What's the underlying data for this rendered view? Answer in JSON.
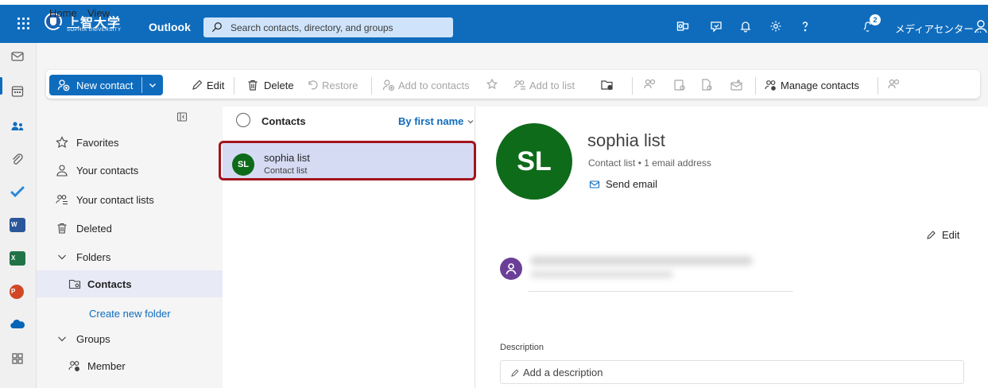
{
  "header": {
    "university_name_jp": "上智大学",
    "university_name_en": "SOPHIA UNIVERSITY",
    "app_name": "Outlook",
    "search_placeholder": "Search contacts, directory, and groups",
    "notification_count": "2",
    "user_name": "メディアセンター..."
  },
  "tabs": [
    {
      "label": "Home",
      "active": true
    },
    {
      "label": "View",
      "active": false
    }
  ],
  "ribbon": {
    "new_contact": "New contact",
    "edit": "Edit",
    "delete": "Delete",
    "restore": "Restore",
    "add_to_contacts": "Add to contacts",
    "add_to_list": "Add to list",
    "manage_contacts": "Manage contacts"
  },
  "folders": {
    "items": [
      {
        "label": "Favorites",
        "icon": "star-icon"
      },
      {
        "label": "Your contacts",
        "icon": "person-icon"
      },
      {
        "label": "Your contact lists",
        "icon": "people-list-icon"
      },
      {
        "label": "Deleted",
        "icon": "trash-icon"
      },
      {
        "label": "Folders",
        "icon": "chevron-down-icon"
      },
      {
        "label": "Contacts",
        "icon": "contact-folder-icon",
        "selected": true
      },
      {
        "label": "Create new folder",
        "icon": ""
      },
      {
        "label": "Groups",
        "icon": "chevron-down-icon"
      },
      {
        "label": "Member",
        "icon": "people-check-icon"
      }
    ]
  },
  "list": {
    "title": "Contacts",
    "sort": "By first name",
    "rows": [
      {
        "initials": "SL",
        "name": "sophia list",
        "subtitle": "Contact list",
        "selected": true
      }
    ]
  },
  "detail": {
    "initials": "SL",
    "name": "sophia list",
    "subtitle": "Contact list • 1 email address",
    "send_email": "Send email",
    "edit": "Edit",
    "description_label": "Description",
    "description_placeholder": "Add a description"
  },
  "colors": {
    "brand": "#0f6cbd",
    "avatar_green": "#0e6b1a",
    "member_purple": "#6b3f98",
    "highlight_red": "#a3141c"
  }
}
